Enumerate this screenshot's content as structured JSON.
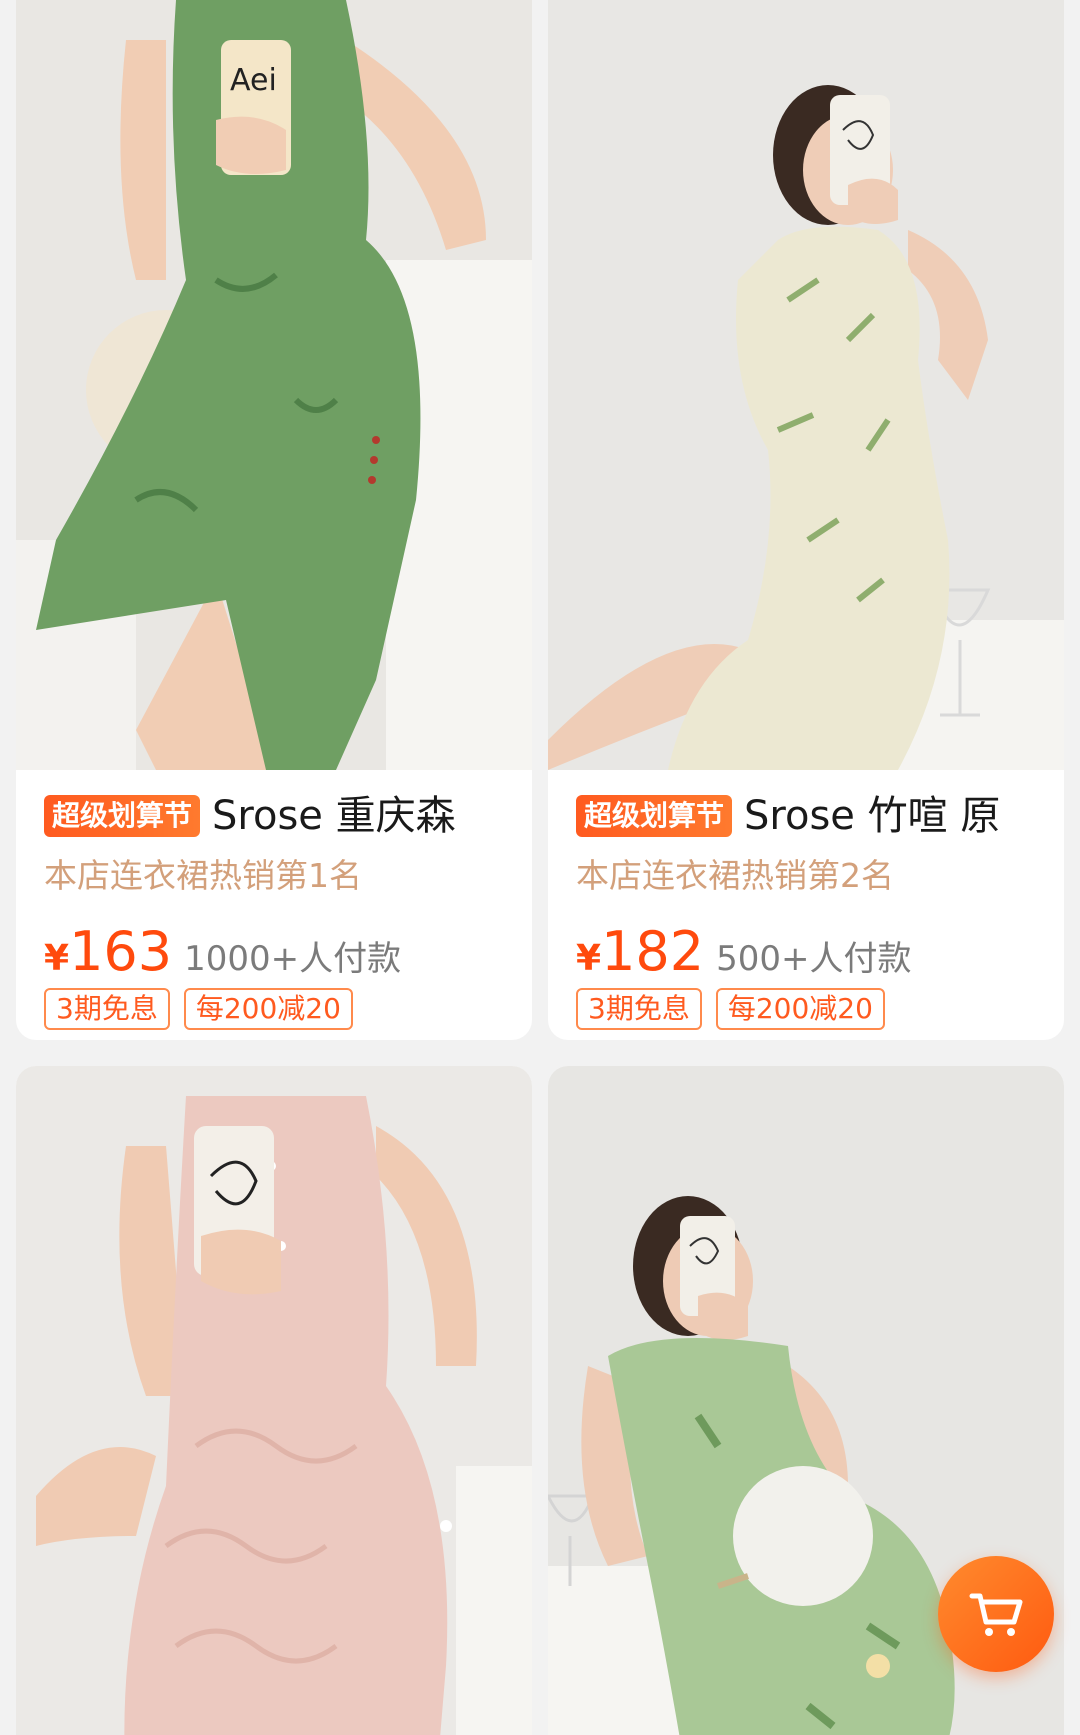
{
  "products": [
    {
      "promo_tag": "超级划算节",
      "title": "Srose 重庆森",
      "rank": "本店连衣裙热销第1名",
      "price_symbol": "¥",
      "price": "163",
      "paid": "1000+人付款",
      "badges": [
        "3期免息",
        "每200减20"
      ],
      "dress_color": "#6f9f63",
      "phone_text": "Aei"
    },
    {
      "promo_tag": "超级划算节",
      "title": "Srose 竹喧 原",
      "rank": "本店连衣裙热销第2名",
      "price_symbol": "¥",
      "price": "182",
      "paid": "500+人付款",
      "badges": [
        "3期免息",
        "每200减20"
      ],
      "dress_color": "#ece8d2"
    },
    {
      "dress_color": "#ecc9c0"
    },
    {
      "dress_color": "#a9c896"
    }
  ],
  "cart": {
    "icon": "shopping-cart-icon",
    "color": "#ff6a1a"
  }
}
